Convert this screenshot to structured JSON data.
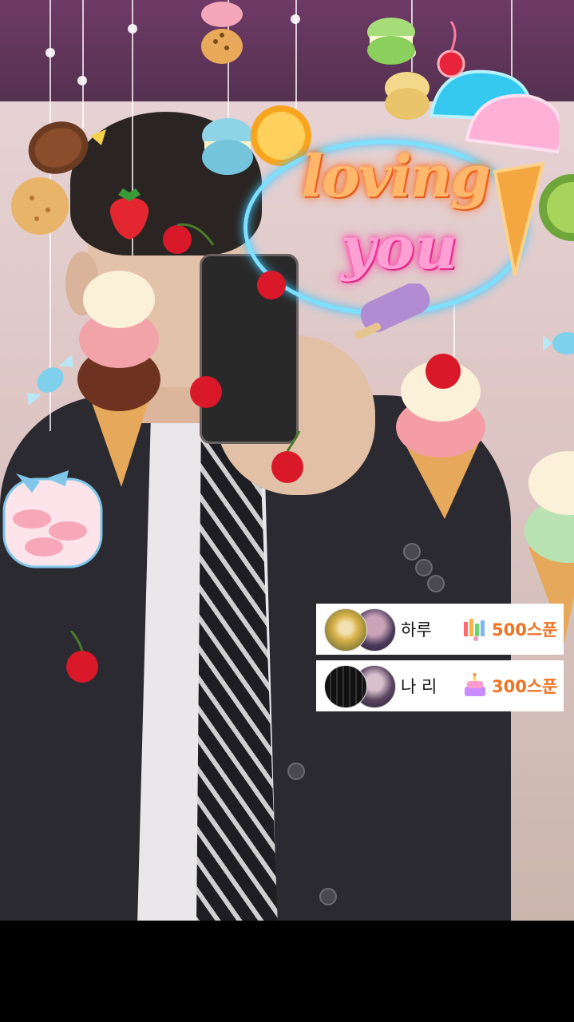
{
  "neon_sign": {
    "line1": "loving",
    "line2": "you"
  },
  "donations": [
    {
      "name": "하루",
      "amount": "500스푼",
      "gift_icon": "rainbow-confetti-icon"
    },
    {
      "name": "나 리",
      "amount": "300스푼",
      "gift_icon": "cake-icon"
    }
  ],
  "colors": {
    "top_band": "#5e3358",
    "amount_text": "#f07322",
    "card_background": "#ffffff",
    "bottom_bar": "#000000"
  }
}
